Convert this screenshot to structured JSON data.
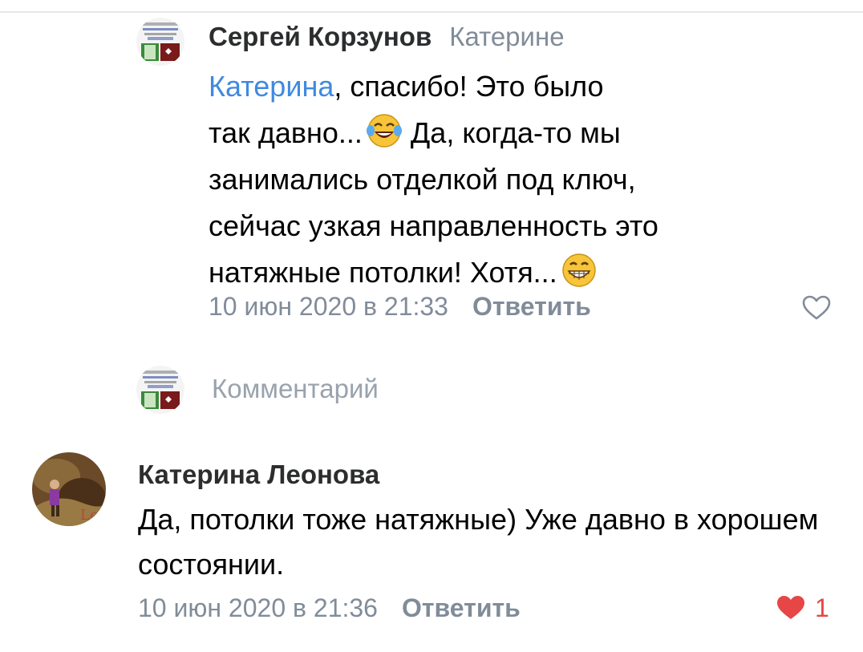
{
  "comments": [
    {
      "author": "Сергей Корзунов",
      "reply_to": "Катерине",
      "mention": "Катерина",
      "text_line1_rest": ", спасибо! Это было",
      "text_line2_a": "так давно...",
      "text_line2_b": " Да, когда-то мы",
      "text_line3": "занимались отделкой под ключ,",
      "text_line4": "сейчас узкая направленность это",
      "text_line5": "натяжные потолки! Хотя...",
      "timestamp": "10 июн 2020 в 21:33",
      "reply_label": "Ответить",
      "emoji_1": "tears-of-joy-emoji",
      "emoji_2": "grinning-emoji",
      "like_icon": "heart-outline-icon"
    },
    {
      "author": "Катерина Леонова",
      "text": "Да, потолки тоже натяжные) Уже давно в хорошем состоянии.",
      "timestamp": "10 июн 2020 в 21:36",
      "reply_label": "Ответить",
      "likes": "1",
      "like_icon": "heart-filled-icon"
    }
  ],
  "composer": {
    "placeholder": "Комментарий"
  },
  "colors": {
    "link": "#3f8ae0",
    "secondary": "#818c99",
    "author": "#2c2d2e",
    "like_active": "#e64646",
    "placeholder": "#99a2ad"
  }
}
